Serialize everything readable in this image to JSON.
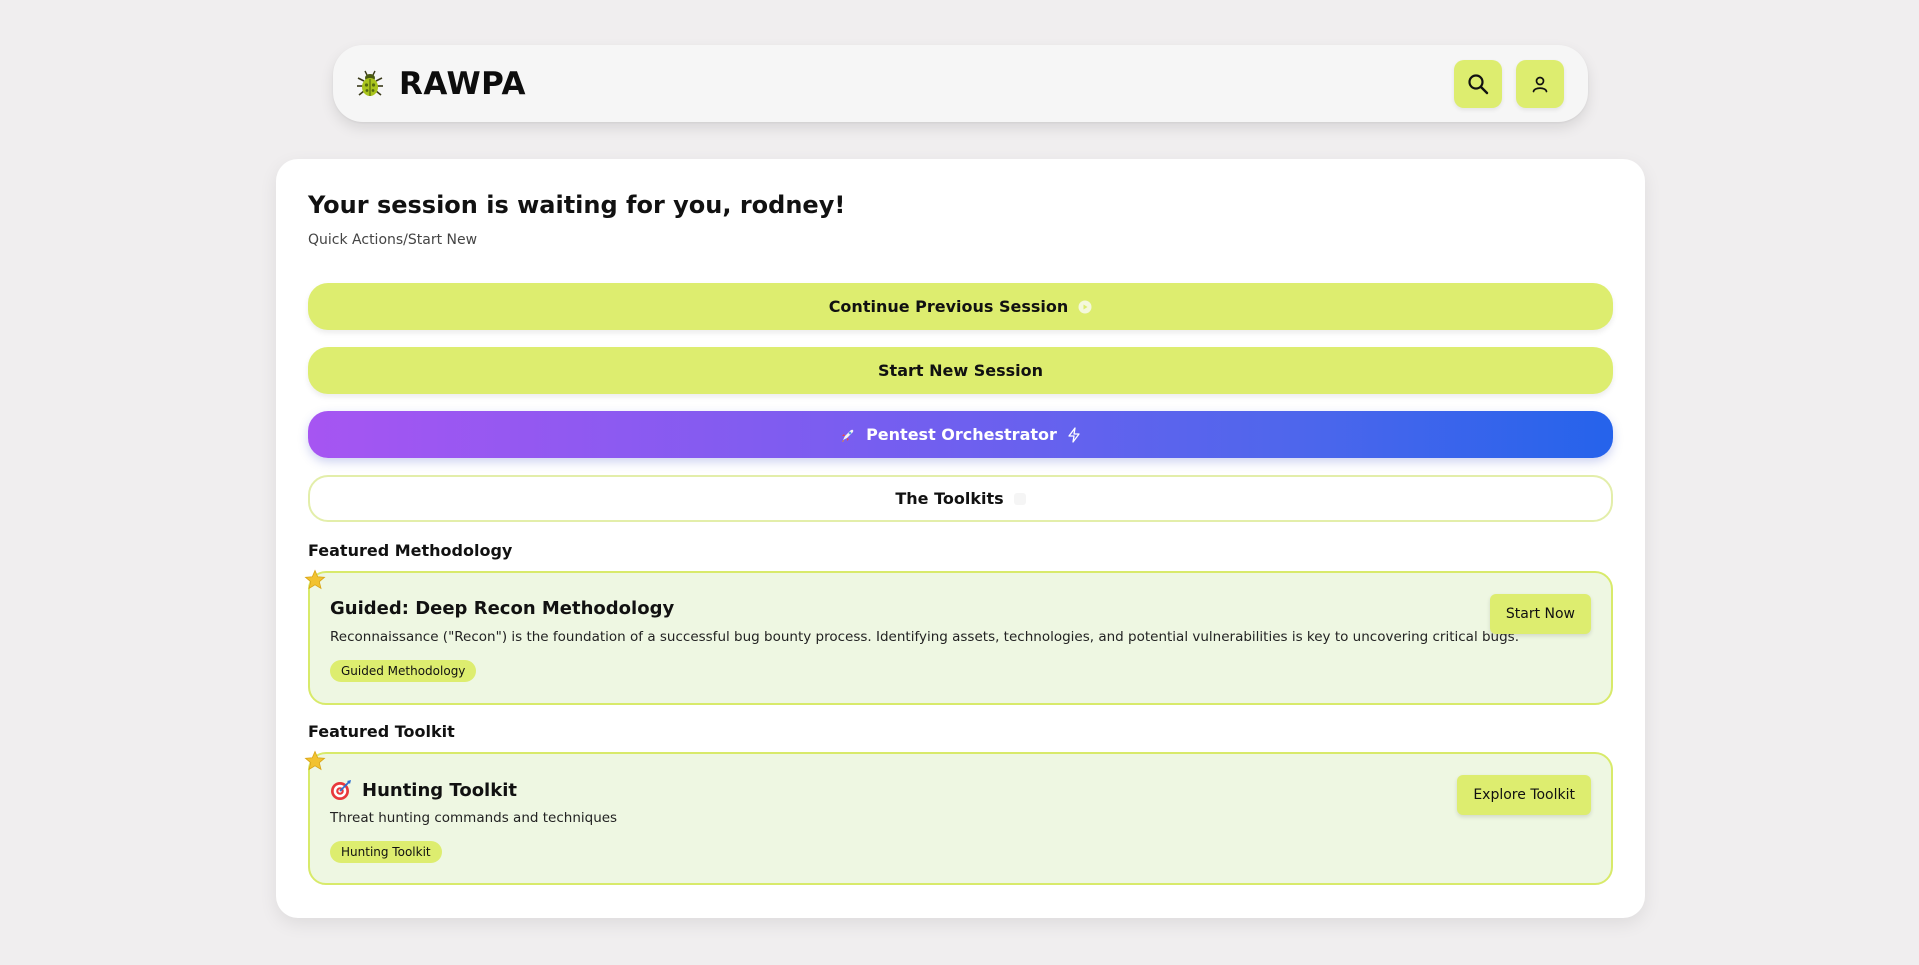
{
  "header": {
    "brand_name": "RAWPA",
    "logo_icon": "bug-icon",
    "search_icon": "search-icon",
    "profile_icon": "user-icon"
  },
  "main": {
    "title": "Your session is waiting for you, rodney!",
    "subtitle": "Quick Actions/Start New",
    "buttons": {
      "continue_label": "Continue Previous Session",
      "new_label": "Start New Session",
      "orchestrator_label": "Pentest Orchestrator",
      "toolkits_label": "The Toolkits"
    },
    "featured_methodology": {
      "section_label": "Featured Methodology",
      "title": "Guided: Deep Recon Methodology",
      "description": "Reconnaissance (\"Recon\") is the foundation of a successful bug bounty process. Identifying assets, technologies, and potential vulnerabilities is key to uncovering critical bugs.",
      "tag": "Guided Methodology",
      "button_label": "Start Now"
    },
    "featured_toolkit": {
      "section_label": "Featured Toolkit",
      "title": "Hunting Toolkit",
      "description": "Threat hunting commands and techniques",
      "tag": "Hunting Toolkit",
      "button_label": "Explore Toolkit"
    }
  },
  "colors": {
    "accent": "#dded6f",
    "feature_bg": "#eef7e2",
    "gradient_start": "#a655f2",
    "gradient_end": "#2563eb"
  }
}
